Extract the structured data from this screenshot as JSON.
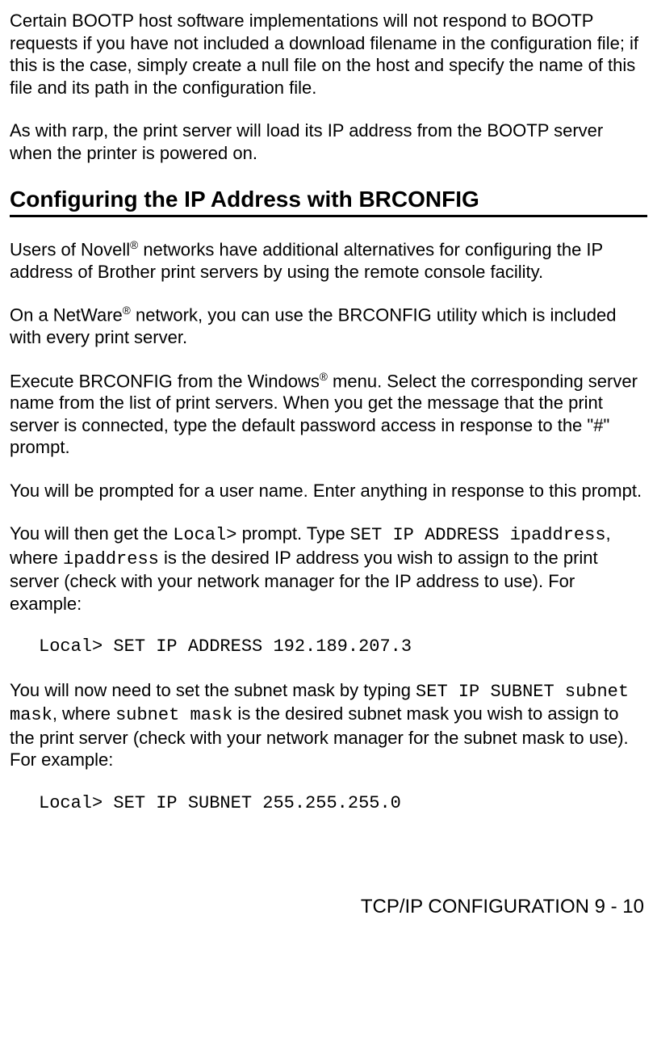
{
  "para1": "Certain BOOTP host software implementations will not respond to BOOTP requests if you have not included a download filename in the configuration file; if this is the case, simply create a null file on the host and specify the name of this file and its path in the configuration file.",
  "para2": "As with rarp, the print server will load its IP address from the BOOTP server when the printer is powered on.",
  "heading1": "Configuring the IP Address with BRCONFIG",
  "para3_a": "Users of Novell",
  "para3_b": " networks have additional alternatives for configuring the IP address of Brother print servers by using the remote console facility.",
  "reg": "®",
  "para4_a": "On a NetWare",
  "para4_b": " network, you can use the BRCONFIG utility which is included with every print server.",
  "para5_a": "Execute BRCONFIG from the Windows",
  "para5_b": " menu. Select the corresponding server name from the list of print servers. When you get the message that the print server is connected, type the default password access in response to the \"#\" prompt.",
  "para6": "You will be prompted for a user name. Enter anything in response to this prompt.",
  "para7_a": "You will then get the ",
  "para7_code1": "Local>",
  "para7_b": " prompt. Type ",
  "para7_code2": "SET IP ADDRESS ipaddress",
  "para7_c": ", where ",
  "para7_code3": "ipaddress",
  "para7_d": " is the desired IP address you wish to assign to the print server (check with your network manager for the IP address to use). For example:",
  "example1": "Local> SET IP ADDRESS 192.189.207.3",
  "para8_a": "You will now need to set the subnet mask by typing ",
  "para8_code1": "SET IP SUBNET subnet mask",
  "para8_b": ", where ",
  "para8_code2": "subnet mask",
  "para8_c": " is the desired subnet mask you wish to assign to the print server (check with your network manager for the subnet mask to use). For example:",
  "example2": "Local> SET IP SUBNET 255.255.255.0",
  "footer": "TCP/IP CONFIGURATION 9 - 10"
}
